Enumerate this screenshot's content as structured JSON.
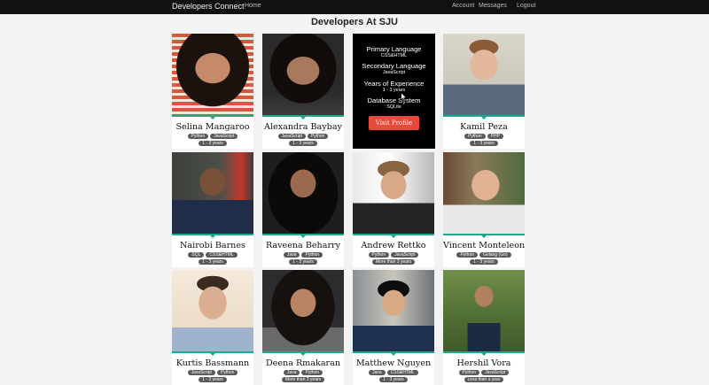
{
  "nav": {
    "brand": "Developers Connect",
    "home": "Home",
    "account": "Account",
    "messages": "Messages",
    "logout": "Logout"
  },
  "page": {
    "title": "Developers At SJU"
  },
  "overlay": {
    "primary_label": "Primary Language",
    "primary_value": "CSS&HTML",
    "secondary_label": "Secondary Language",
    "secondary_value": "JavaScript",
    "experience_label": "Years of Experience",
    "experience_value": "1 - 3 years",
    "database_label": "Database System",
    "database_value": "SQLite",
    "button": "Visit Profile"
  },
  "cards": [
    {
      "name": "Selina Mangaroo",
      "tags": [
        "Python",
        "JavaScript"
      ],
      "experience": "1 - 3 years"
    },
    {
      "name": "Alexandra Baybay",
      "tags": [
        "JavaScript",
        "Python"
      ],
      "experience": "1 - 3 years"
    },
    {
      "name": "Kamil Peza",
      "tags": [
        "Python",
        "PHP"
      ],
      "experience": "1 - 3 years"
    },
    {
      "name": "Nairobi Barnes",
      "tags": [
        "SQL",
        "CSS&HTML"
      ],
      "experience": "1 - 3 years"
    },
    {
      "name": "Raveena Beharry",
      "tags": [
        "Java",
        "Python"
      ],
      "experience": "1 - 3 years"
    },
    {
      "name": "Andrew Rettko",
      "tags": [
        "Python",
        "JavaScript"
      ],
      "experience": "More than 3 years"
    },
    {
      "name": "Vincent Monteleone",
      "tags": [
        "Python",
        "Golang (Go)"
      ],
      "experience": "1 - 3 years"
    },
    {
      "name": "Kurtis Bassmann",
      "tags": [
        "JavaScript",
        "Python"
      ],
      "experience": "1 - 3 years"
    },
    {
      "name": "Deena Rmakaran",
      "tags": [
        "Java",
        "Python"
      ],
      "experience": "More than 3 years"
    },
    {
      "name": "Matthew Nguyen",
      "tags": [
        "Java",
        "CSS&HTML"
      ],
      "experience": "1 - 3 years"
    },
    {
      "name": "Hershil Vora",
      "tags": [
        "Python",
        "JavaScript"
      ],
      "experience": "Less than a year"
    }
  ]
}
